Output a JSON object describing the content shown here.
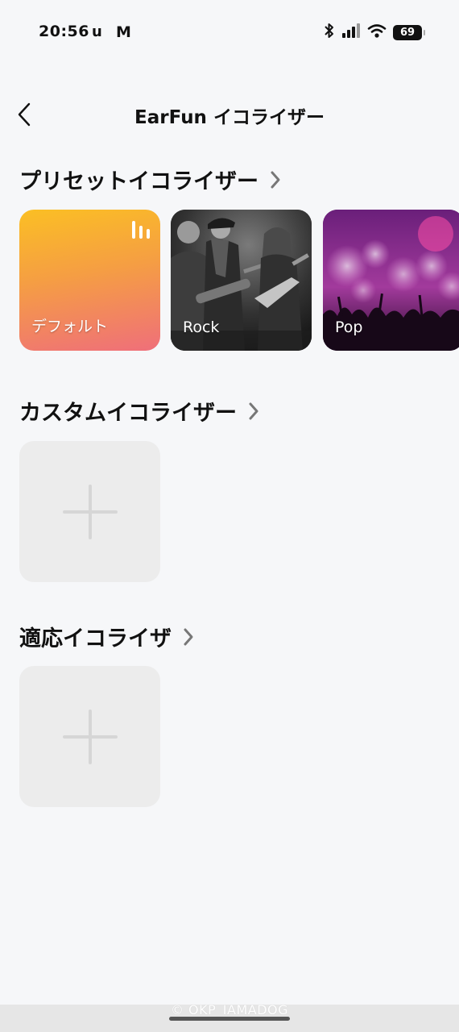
{
  "status_bar": {
    "time": "20:56",
    "app_icons": [
      "u",
      "M"
    ],
    "battery_level": "69",
    "icons": [
      "bluetooth-icon",
      "signal-icon",
      "wifi-icon",
      "battery-icon"
    ]
  },
  "header": {
    "title": "EarFun イコライザー"
  },
  "preset_section": {
    "title": "プリセットイコライザー",
    "presets": [
      {
        "label": "デフォルト",
        "active": true
      },
      {
        "label": "Rock",
        "active": false
      },
      {
        "label": "Pop",
        "active": false
      }
    ]
  },
  "custom_section": {
    "title": "カスタムイコライザー"
  },
  "adaptive_section": {
    "title": "適応イコライザ"
  },
  "watermark": "© OKP_IAMADOG",
  "colors": {
    "background": "#f6f7f9",
    "tile": "#ececec",
    "default_gradient_start": "#fbbf24",
    "default_gradient_end": "#ef6f7a"
  }
}
